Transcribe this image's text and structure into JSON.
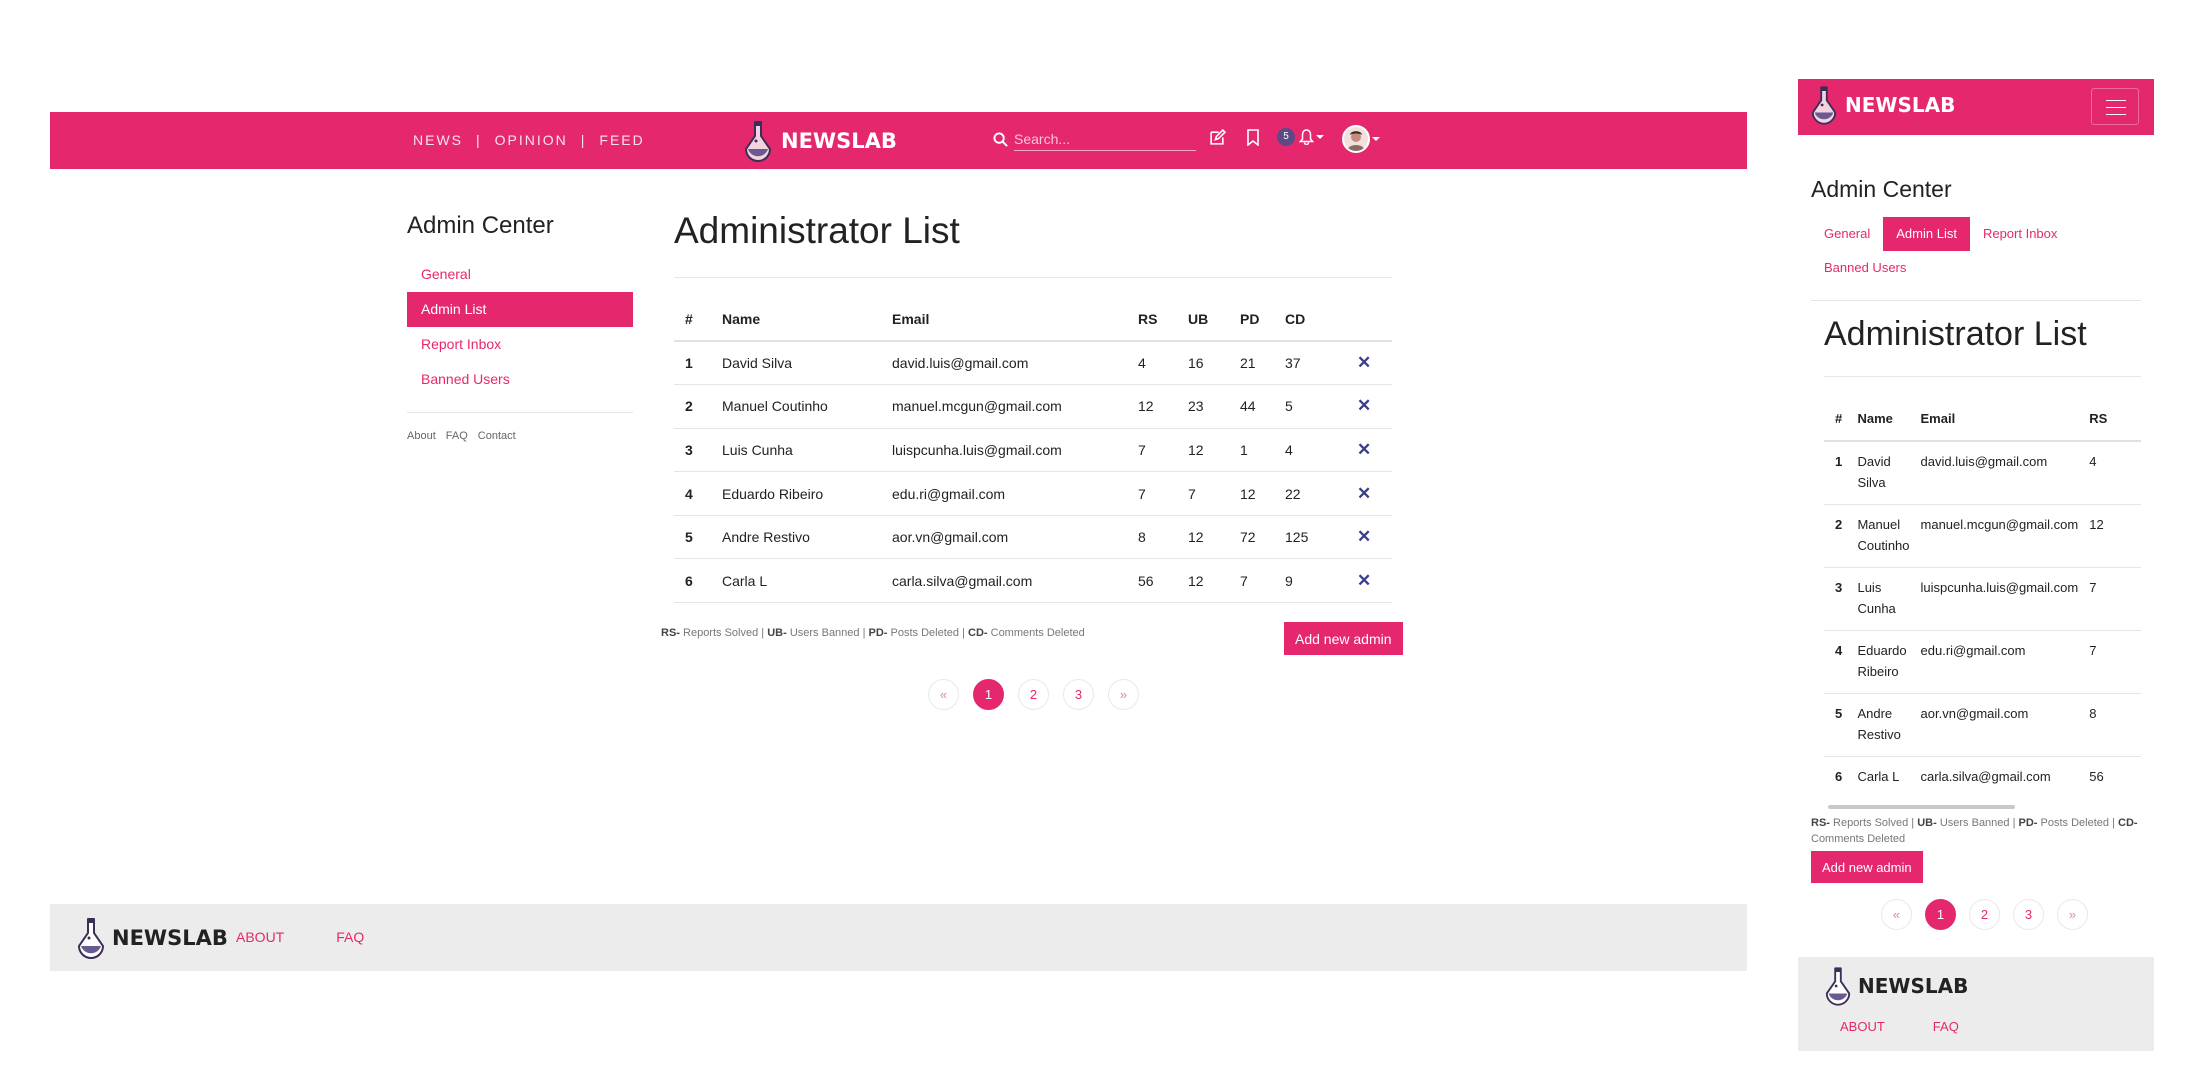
{
  "brand": {
    "name": "NEWSLAB"
  },
  "nav": {
    "links": [
      "NEWS",
      "OPINION",
      "FEED"
    ],
    "search_placeholder": "Search...",
    "notification_count": "5"
  },
  "sidebar": {
    "title": "Admin Center",
    "items": [
      "General",
      "Admin List",
      "Report Inbox",
      "Banned Users"
    ],
    "active": "Admin List",
    "footer_links": [
      "About",
      "FAQ",
      "Contact"
    ]
  },
  "main": {
    "title": "Administrator List",
    "table": {
      "headers": [
        "#",
        "Name",
        "Email",
        "RS",
        "UB",
        "PD",
        "CD"
      ],
      "rows": [
        {
          "idx": "1",
          "name": "David Silva",
          "email": "david.luis@gmail.com",
          "rs": "4",
          "ub": "16",
          "pd": "21",
          "cd": "37"
        },
        {
          "idx": "2",
          "name": "Manuel Coutinho",
          "email": "manuel.mcgun@gmail.com",
          "rs": "12",
          "ub": "23",
          "pd": "44",
          "cd": "5"
        },
        {
          "idx": "3",
          "name": "Luis Cunha",
          "email": "luispcunha.luis@gmail.com",
          "rs": "7",
          "ub": "12",
          "pd": "1",
          "cd": "4"
        },
        {
          "idx": "4",
          "name": "Eduardo Ribeiro",
          "email": "edu.ri@gmail.com",
          "rs": "7",
          "ub": "7",
          "pd": "12",
          "cd": "22"
        },
        {
          "idx": "5",
          "name": "Andre Restivo",
          "email": "aor.vn@gmail.com",
          "rs": "8",
          "ub": "12",
          "pd": "72",
          "cd": "125"
        },
        {
          "idx": "6",
          "name": "Carla L",
          "email": "carla.silva@gmail.com",
          "rs": "56",
          "ub": "12",
          "pd": "7",
          "cd": "9"
        }
      ],
      "delete_symbol": "✕"
    },
    "legend": [
      {
        "key": "RS-",
        "text": " Reports Solved"
      },
      {
        "key": "UB-",
        "text": " Users Banned"
      },
      {
        "key": "PD-",
        "text": " Posts Deleted"
      },
      {
        "key": "CD-",
        "text": " Comments Deleted"
      }
    ],
    "legend_separator": " | ",
    "add_button": "Add new admin",
    "pagination": {
      "prev": "«",
      "pages": [
        "1",
        "2",
        "3"
      ],
      "next": "»",
      "current": "1"
    }
  },
  "mobile": {
    "name_lines": [
      [
        "David",
        "Silva"
      ],
      [
        "Manuel",
        "Coutinho"
      ],
      [
        "Luis",
        "Cunha"
      ],
      [
        "Eduardo",
        "Ribeiro"
      ],
      [
        "Andre",
        "Restivo"
      ],
      [
        "Carla L"
      ]
    ]
  },
  "footer": {
    "links": [
      "ABOUT",
      "FAQ"
    ]
  },
  "colors": {
    "accent": "#e5286e",
    "footer_bg": "#ececec",
    "delete_icon": "#3b3f8a",
    "badge": "#5b4a86"
  }
}
